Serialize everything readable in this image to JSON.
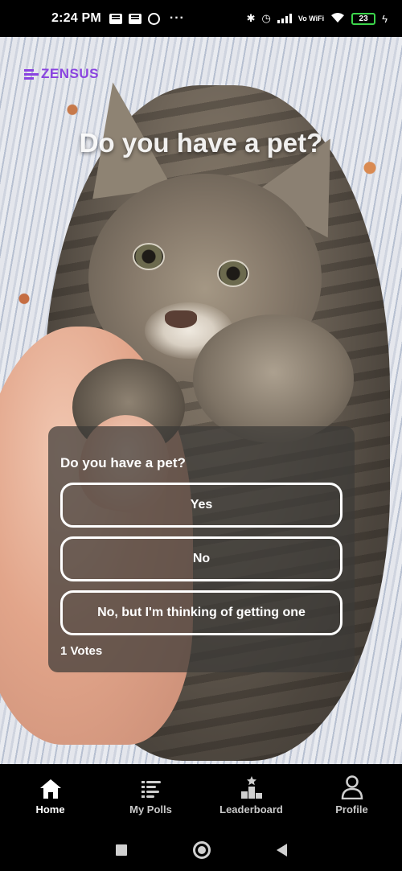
{
  "status_bar": {
    "time": "2:24 PM",
    "network_label": "Vo WiFi",
    "battery_level": "23",
    "battery_fraction": 0.23,
    "battery_color": "#3cd54b"
  },
  "brand": {
    "name": "ZENSUS",
    "color": "#8a43e0"
  },
  "hero": {
    "title": "Do you have a pet?"
  },
  "poll": {
    "question": "Do you have a pet?",
    "options": [
      "Yes",
      "No",
      "No, but I'm thinking of getting one"
    ],
    "votes_label": "1 Votes"
  },
  "bottom_nav": {
    "items": [
      {
        "label": "Home",
        "icon": "home-icon",
        "active": true
      },
      {
        "label": "My Polls",
        "icon": "list-icon",
        "active": false
      },
      {
        "label": "Leaderboard",
        "icon": "leaderboard-icon",
        "active": false
      },
      {
        "label": "Profile",
        "icon": "profile-icon",
        "active": false
      }
    ]
  },
  "system_nav": {
    "buttons": [
      "recents-icon",
      "home-circle-icon",
      "back-icon"
    ]
  }
}
